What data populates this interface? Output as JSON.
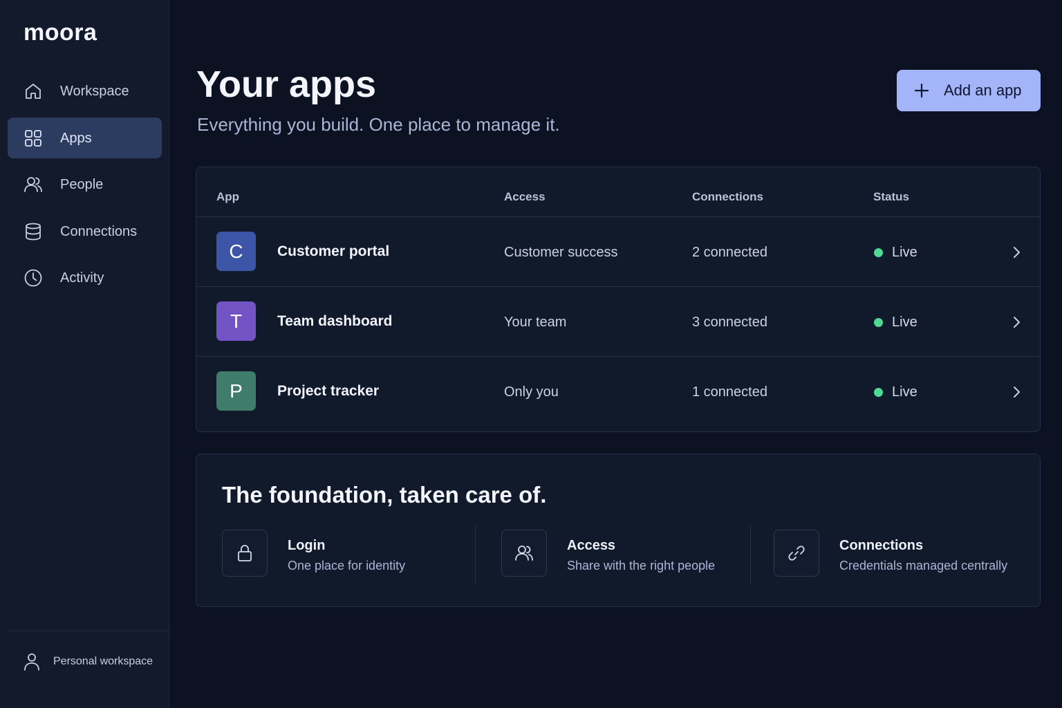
{
  "brand": {
    "name": "moora"
  },
  "sidebar": {
    "items": [
      {
        "label": "Workspace",
        "icon": "home-icon",
        "active": false
      },
      {
        "label": "Apps",
        "icon": "grid-icon",
        "active": true
      },
      {
        "label": "People",
        "icon": "people-icon",
        "active": false
      },
      {
        "label": "Connections",
        "icon": "database-icon",
        "active": false
      },
      {
        "label": "Activity",
        "icon": "clock-icon",
        "active": false
      }
    ],
    "footer_label": "Personal workspace"
  },
  "header": {
    "title": "Your apps",
    "subtitle": "Everything you build. One place to manage it.",
    "add_button_label": "Add an app"
  },
  "table": {
    "columns": [
      "App",
      "Access",
      "Connections",
      "Status"
    ],
    "rows": [
      {
        "initial": "C",
        "name": "Customer portal",
        "access": "Customer success",
        "connections": "2 connected",
        "status": "Live",
        "avatar_color": "#3d55a6"
      },
      {
        "initial": "T",
        "name": "Team dashboard",
        "access": "Your team",
        "connections": "3 connected",
        "status": "Live",
        "avatar_color": "#7354c4"
      },
      {
        "initial": "P",
        "name": "Project tracker",
        "access": "Only you",
        "connections": "1 connected",
        "status": "Live",
        "avatar_color": "#3f7d6a"
      }
    ]
  },
  "foundation": {
    "title": "The foundation, taken care of.",
    "features": [
      {
        "title": "Login",
        "desc": "One place for identity",
        "icon": "lock-icon"
      },
      {
        "title": "Access",
        "desc": "Share with the right people",
        "icon": "people-icon"
      },
      {
        "title": "Connections",
        "desc": "Credentials managed centrally",
        "icon": "link-icon"
      }
    ]
  },
  "colors": {
    "accent": "#a4b4f8",
    "live": "#4fd896",
    "background": "#0c1222",
    "sidebar": "#121a2c"
  }
}
